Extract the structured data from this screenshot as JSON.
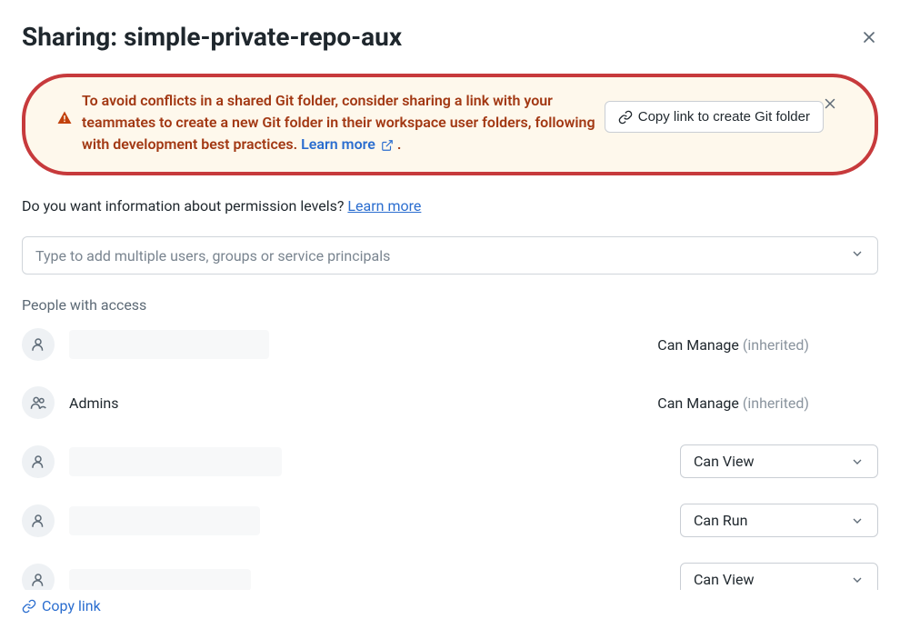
{
  "dialog": {
    "title": "Sharing: simple-private-repo-aux"
  },
  "alert": {
    "text": "To avoid conflicts in a shared Git folder, consider sharing a link with your teammates to create a new Git folder in their workspace user folders, following with development best practices.",
    "learn_more": "Learn more",
    "copy_button": "Copy link to create Git folder"
  },
  "permission_info": {
    "question": "Do you want information about permission levels?",
    "learn_more": "Learn more"
  },
  "add_input": {
    "placeholder": "Type to add multiple users, groups or service principals"
  },
  "section": {
    "label": "People with access"
  },
  "rows": [
    {
      "name": "",
      "permission": "Can Manage",
      "suffix": "(inherited)",
      "type": "text",
      "avatar": "single",
      "redacted": true
    },
    {
      "name": "Admins",
      "permission": "Can Manage",
      "suffix": "(inherited)",
      "type": "text",
      "avatar": "group",
      "redacted": false
    },
    {
      "name": "",
      "permission": "Can View",
      "type": "select",
      "avatar": "single",
      "redacted": true
    },
    {
      "name": "",
      "permission": "Can Run",
      "type": "select",
      "avatar": "single",
      "redacted": true
    },
    {
      "name": "",
      "permission": "Can View",
      "type": "select",
      "avatar": "single",
      "redacted": true
    }
  ],
  "footer": {
    "copy_link": "Copy link"
  }
}
